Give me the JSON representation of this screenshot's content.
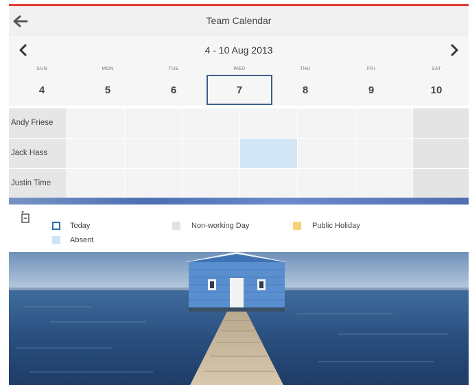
{
  "header": {
    "title": "Team Calendar",
    "back_icon": "back-arrow-icon",
    "accent_color": "#e53935"
  },
  "week": {
    "range": "4 - 10 Aug 2013",
    "prev_icon": "chevron-left-icon",
    "next_icon": "chevron-right-icon",
    "days": [
      {
        "name": "SUN",
        "date": "4"
      },
      {
        "name": "MON",
        "date": "5"
      },
      {
        "name": "TUE",
        "date": "6"
      },
      {
        "name": "WED",
        "date": "7"
      },
      {
        "name": "THU",
        "date": "8"
      },
      {
        "name": "FRI",
        "date": "9"
      },
      {
        "name": "SAT",
        "date": "10"
      }
    ],
    "today": "7"
  },
  "members": [
    {
      "name": "Andy Friese",
      "absent_days": [],
      "non_working_days": [
        "10"
      ]
    },
    {
      "name": "Jack Hass",
      "absent_days": [
        "7"
      ],
      "non_working_days": [
        "10"
      ]
    },
    {
      "name": "Justin Time",
      "absent_days": [],
      "non_working_days": [
        "10"
      ]
    }
  ],
  "legend": {
    "today": "Today",
    "absent": "Absent",
    "non_working": "Non-working Day",
    "public_holiday": "Public Holiday",
    "colors": {
      "today": "#2f6fb0",
      "absent": "#cfe3f6",
      "non_working": "#e2e2e2",
      "public_holiday": "#f7d27a"
    }
  },
  "photo": {
    "subject": "blue boatshed on water with wooden jetty"
  }
}
